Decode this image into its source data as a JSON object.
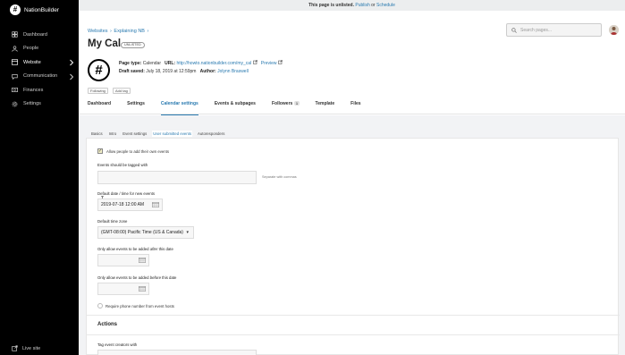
{
  "brand": {
    "logo_glyph": "#",
    "name": "NationBuilder"
  },
  "sidebar": {
    "items": [
      {
        "label": "Dashboard",
        "icon": "dashboard-icon"
      },
      {
        "label": "People",
        "icon": "people-icon"
      },
      {
        "label": "Website",
        "icon": "website-icon",
        "active": true,
        "chevron": true
      },
      {
        "label": "Communication",
        "icon": "communication-icon",
        "chevron": true
      },
      {
        "label": "Finances",
        "icon": "finances-icon"
      },
      {
        "label": "Settings",
        "icon": "settings-icon"
      }
    ],
    "live_site": "Live site"
  },
  "topbar": {
    "text_pre": "This page is unlisted.",
    "publish": "Publish",
    "or": "or",
    "schedule": "Schedule"
  },
  "header": {
    "breadcrumb": [
      "Websites",
      "Explaining NB"
    ],
    "title": "My Cal",
    "badge": "UNLISTED",
    "search_placeholder": "Search pages...",
    "page_icon_glyph": "#",
    "meta": {
      "page_type_label": "Page type:",
      "page_type": "Calendar",
      "url_label": "URL:",
      "url": "http://howto.nationbuilder.com/my_cal",
      "preview": "Preview",
      "draft_label": "Draft saved:",
      "draft_date": "July 18, 2019 at 12:59pm",
      "author_label": "Author:",
      "author": "Jolynn Braswell"
    },
    "pills": [
      "Following",
      "Add tag"
    ],
    "tabs": [
      {
        "label": "Dashboard"
      },
      {
        "label": "Settings"
      },
      {
        "label": "Calendar settings",
        "active": true
      },
      {
        "label": "Events & subpages"
      },
      {
        "label": "Followers",
        "count": "1"
      },
      {
        "label": "Template"
      },
      {
        "label": "Files"
      }
    ]
  },
  "subtabs": [
    {
      "label": "Basics"
    },
    {
      "label": "Intro"
    },
    {
      "label": "Event settings"
    },
    {
      "label": "User submitted events",
      "active": true
    },
    {
      "label": "Autoresponders"
    }
  ],
  "form": {
    "allow_label": "Allow people to add their own events",
    "tagged_label": "Events should be tagged with",
    "tagged_hint": "Separate with commas",
    "default_date_label": "Default date / time for new events",
    "default_date_value": "2019-07-18 12:00 AM",
    "timezone_label": "Default time zone",
    "timezone_value": "(GMT-08:00) Pacific Time (US & Canada)",
    "after_label_pre": "Only allow events to be added",
    "after_label_em": "after",
    "after_label_post": "this date",
    "before_label_pre": "Only allow events to be added",
    "before_label_em": "before",
    "before_label_post": "this date",
    "phone_label": "Require phone number from event hosts",
    "actions_title": "Actions",
    "tag_creators_label": "Tag event creators with"
  }
}
